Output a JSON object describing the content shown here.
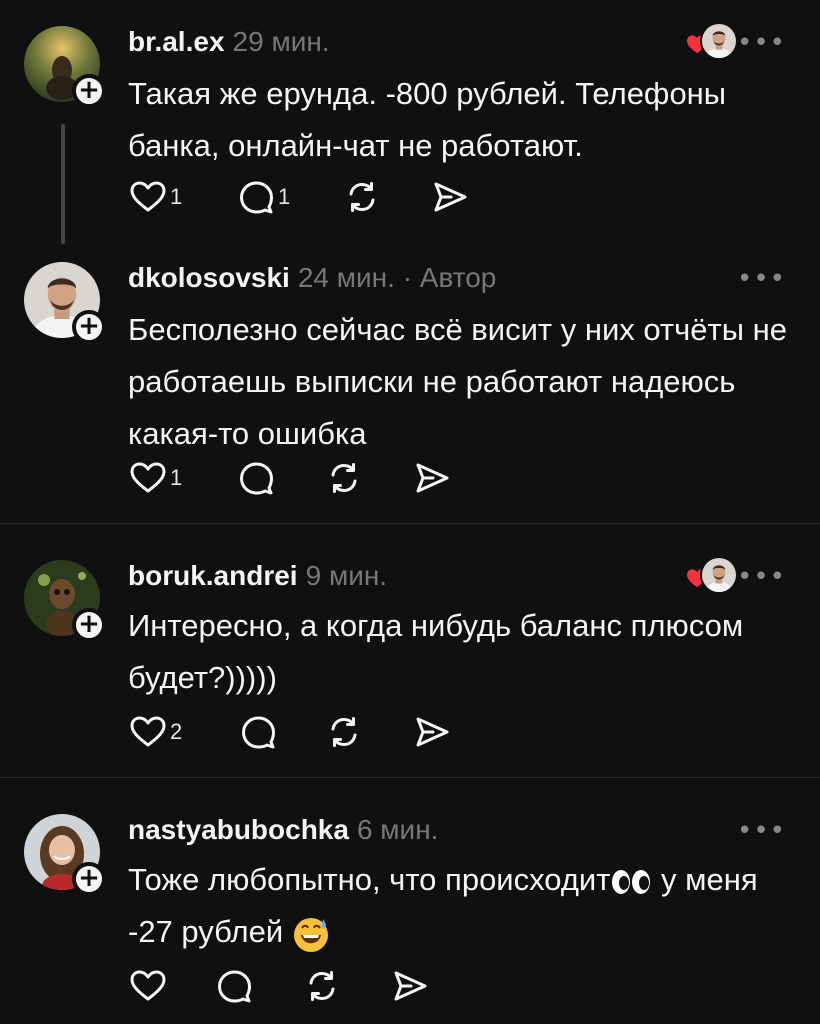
{
  "colors": {
    "background": "#101010",
    "text": "#f3f5f7",
    "muted": "#777777",
    "like_red": "#ff3040"
  },
  "posts": [
    {
      "username": "br.al.ex",
      "time": "29 мин.",
      "author_tag": "",
      "text": "Такая же ерунда. -800 рублей. Телефоны банка, онлайн-чат не работают.",
      "likes": "1",
      "replies": "1",
      "liked_by_author": true
    },
    {
      "username": "dkolosovski",
      "time": "24 мин.",
      "author_tag": "· Автор",
      "text": "Бесполезно сейчас всё висит у них отчёты не работаешь выписки не работают надеюсь какая-то ошибка",
      "likes": "1",
      "replies": "",
      "liked_by_author": false
    },
    {
      "username": "boruk.andrei",
      "time": "9 мин.",
      "author_tag": "",
      "text": "Интересно, а когда нибудь баланс плюсом будет?)))))",
      "likes": "2",
      "replies": "",
      "liked_by_author": true
    },
    {
      "username": "nastyabubochka",
      "time": "6 мин.",
      "author_tag": "",
      "text_part1": "Тоже любопытно, что происходит",
      "text_part2": " у меня -27 рублей ",
      "likes": "",
      "replies": "",
      "liked_by_author": false
    }
  ],
  "icons": {
    "more": "more-dots-icon",
    "like": "heart-outline-icon",
    "reply": "comment-bubble-icon",
    "repost": "repost-arrows-icon",
    "share": "send-icon",
    "follow": "plus-icon"
  }
}
